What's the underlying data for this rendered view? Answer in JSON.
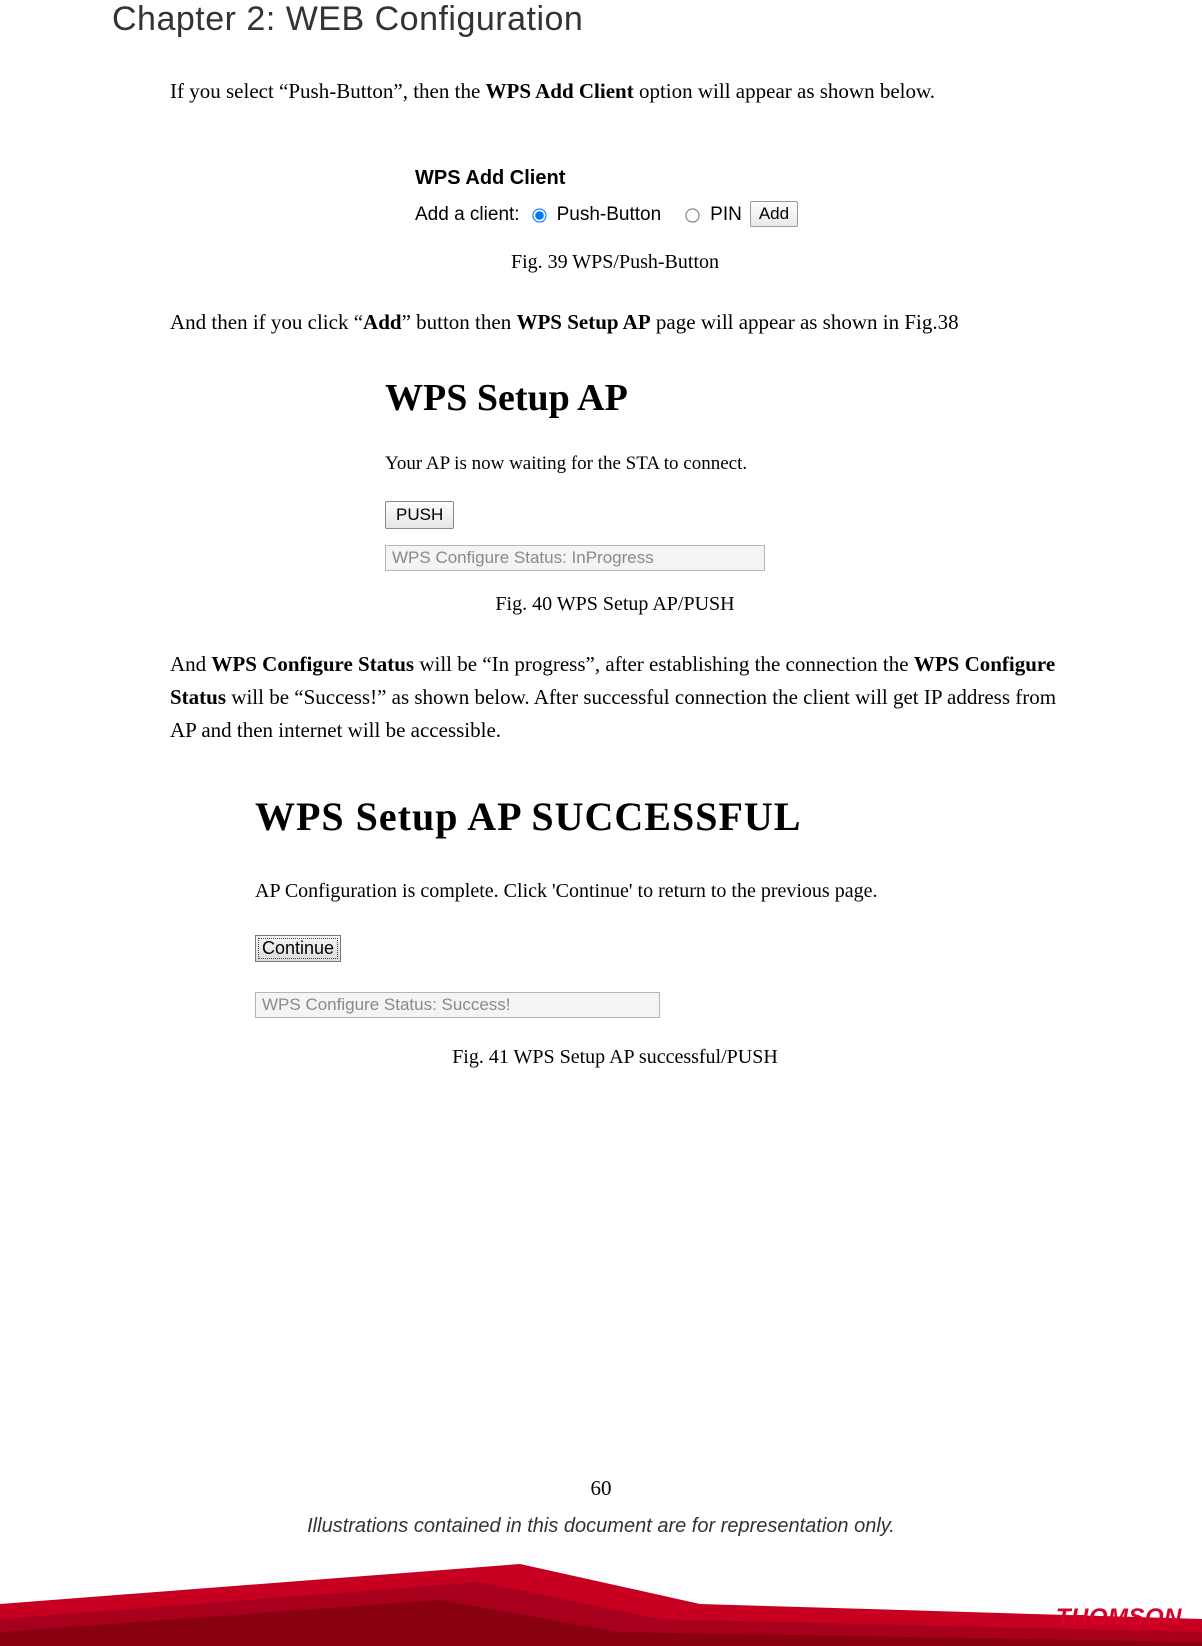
{
  "chapter_title": "Chapter 2: WEB Configuration",
  "para1": {
    "pre": "If you select “Push-Button”, then the ",
    "bold": "WPS Add Client",
    "post": " option will appear as shown below."
  },
  "fig39": {
    "title": "WPS Add Client",
    "label": "Add a client:",
    "opt_push": "Push-Button",
    "opt_pin": "PIN",
    "btn_add": "Add",
    "caption": "Fig. 39 WPS/Push-Button"
  },
  "para2": {
    "pre": "And then if you click “",
    "bold1": "Add",
    "mid": "” button then ",
    "bold2": "WPS Setup AP",
    "post": " page will appear as shown in Fig.38"
  },
  "fig40": {
    "title": "WPS Setup AP",
    "sub": "Your AP is now waiting for the STA to connect.",
    "btn_push": "PUSH",
    "status": "WPS Configure Status: InProgress",
    "caption": "Fig. 40 WPS Setup AP/PUSH"
  },
  "para3": {
    "s1": "And ",
    "b1": "WPS Configure Status",
    "s2": " will be “In progress”, after establishing the connection the ",
    "b2": "WPS Configure Status",
    "s3": " will be “Success!” as shown below. After successful connection the client will get IP address from AP and then internet will be accessible."
  },
  "fig41": {
    "title": "WPS Setup AP SUCCESSFUL",
    "sub": "AP Configuration is complete. Click 'Continue' to return to the previous page.",
    "btn_continue": "Continue",
    "status": "WPS Configure Status: Success!",
    "caption": "Fig. 41 WPS Setup AP successful/PUSH"
  },
  "page_number": "60",
  "disclaimer": "Illustrations contained in this document are for representation only.",
  "brand": "THOMSON"
}
